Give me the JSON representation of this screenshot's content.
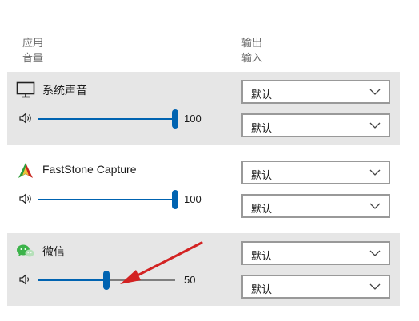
{
  "header": {
    "left_line1": "应用",
    "left_line2": "音量",
    "right_line1": "输出",
    "right_line2": "输入"
  },
  "apps": [
    {
      "name": "系统声音",
      "icon": "monitor-icon",
      "volume": 100,
      "volume_label": "100",
      "output": "默认",
      "input": "默认"
    },
    {
      "name": "FastStone Capture",
      "icon": "faststone-icon",
      "volume": 100,
      "volume_label": "100",
      "output": "默认",
      "input": "默认"
    },
    {
      "name": "微信",
      "icon": "wechat-icon",
      "volume": 50,
      "volume_label": "50",
      "output": "默认",
      "input": "默认"
    }
  ],
  "colors": {
    "accent": "#0063b1",
    "row_bg": "#e6e6e6",
    "arrow": "#d32222"
  }
}
